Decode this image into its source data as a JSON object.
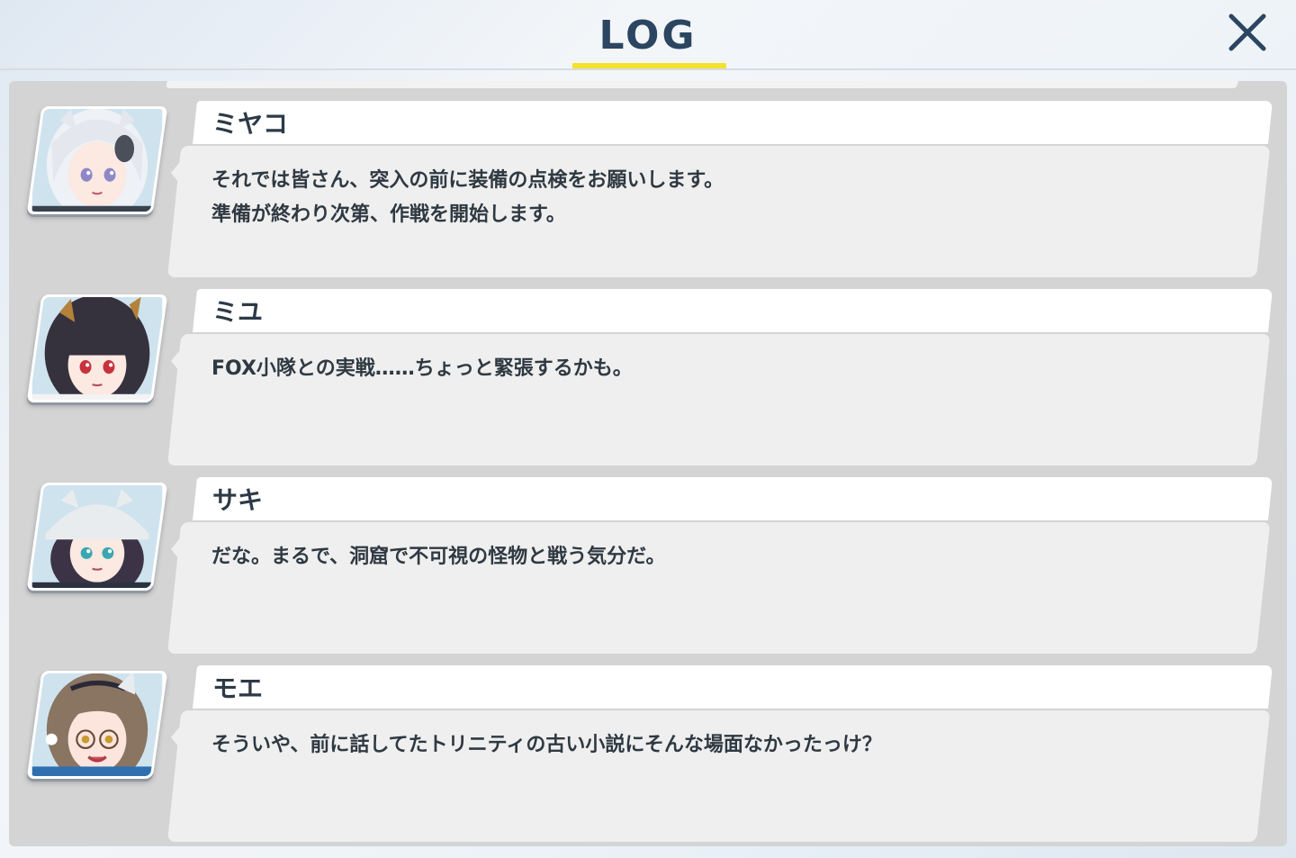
{
  "header": {
    "title": "LOG",
    "close_icon": "close-icon",
    "accent_color": "#f4e12c"
  },
  "entries": [
    {
      "name": "ミヤコ",
      "lines": [
        "それでは皆さん、突入の前に装備の点検をお願いします。",
        "準備が終わり次第、作戦を開始します。"
      ],
      "portrait_icon": "character-portrait"
    },
    {
      "name": "ミユ",
      "lines": [
        "FOX小隊との実戦……ちょっと緊張するかも。"
      ],
      "portrait_icon": "character-portrait"
    },
    {
      "name": "サキ",
      "lines": [
        "だな。まるで、洞窟で不可視の怪物と戦う気分だ。"
      ],
      "portrait_icon": "character-portrait"
    },
    {
      "name": "モエ",
      "lines": [
        "そういや、前に話してたトリニティの古い小説にそんな場面なかったっけ？"
      ],
      "portrait_icon": "character-portrait"
    }
  ]
}
